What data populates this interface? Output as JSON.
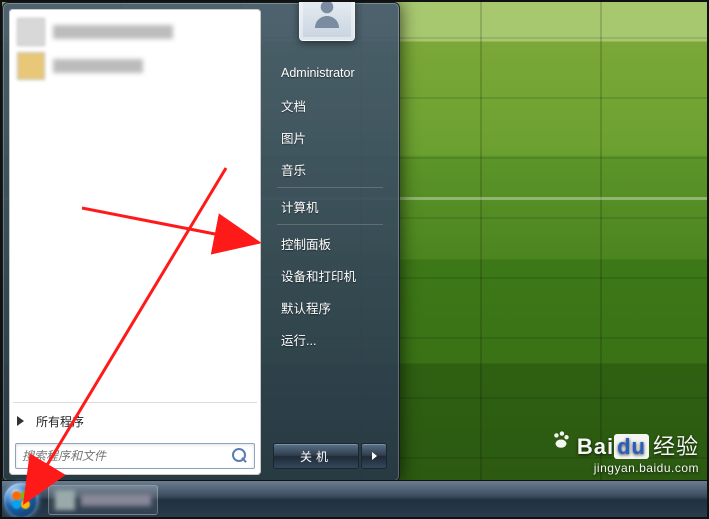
{
  "start_menu": {
    "all_programs_label": "所有程序",
    "search_placeholder": "搜索程序和文件",
    "right_items": [
      {
        "label": "Administrator"
      },
      {
        "label": "文档"
      },
      {
        "label": "图片"
      },
      {
        "label": "音乐"
      },
      {
        "label": "计算机"
      },
      {
        "label": "控制面板"
      },
      {
        "label": "设备和打印机"
      },
      {
        "label": "默认程序"
      },
      {
        "label": "运行..."
      }
    ],
    "shutdown_label": "关机"
  },
  "watermark": {
    "brand_a": "Bai",
    "brand_b": "du",
    "brand_c": "经验",
    "url": "jingyan.baidu.com"
  }
}
